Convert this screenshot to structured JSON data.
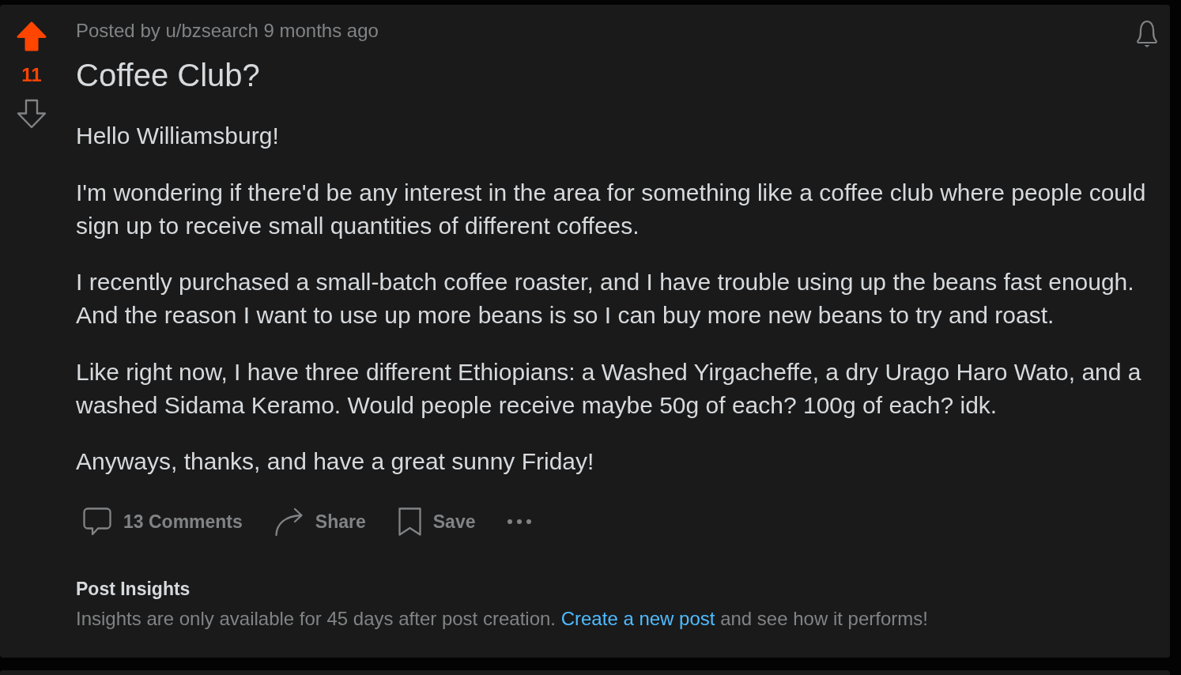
{
  "post": {
    "vote": {
      "upvoted": true,
      "score": "11",
      "downvoted": false
    },
    "meta": "Posted by u/bzsearch 9 months ago",
    "title": "Coffee Club?",
    "body": [
      "Hello Williamsburg!",
      "I'm wondering if there'd be any interest in the area for something like a coffee club where people could sign up to receive small quantities of different coffees.",
      "I recently purchased a small-batch coffee roaster, and I have trouble using up the beans fast enough. And the reason I want to use up more beans is so I can buy more new beans to try and roast.",
      "Like right now, I have three different Ethiopians: a Washed Yirgacheffe, a dry Urago Haro Wato, and a washed Sidama Keramo. Would people receive maybe 50g of each? 100g of each? idk.",
      "Anyways, thanks, and have a great sunny Friday!"
    ],
    "actions": [
      {
        "kind": "comments",
        "label": "13 Comments"
      },
      {
        "kind": "share",
        "label": "Share"
      },
      {
        "kind": "save",
        "label": "Save"
      },
      {
        "kind": "more"
      }
    ]
  },
  "insights": {
    "heading": "Post Insights",
    "text_before": "Insights are only available for 45 days after post creation.",
    "link": "Create a new post",
    "text_after": "and see how it performs!"
  }
}
